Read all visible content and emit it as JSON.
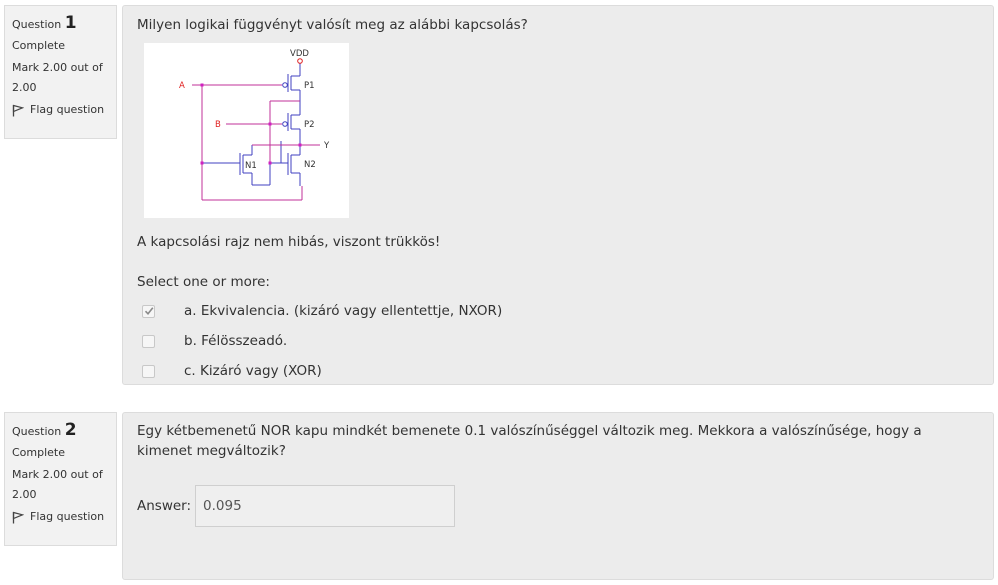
{
  "questions": [
    {
      "prefix": "Question",
      "number": "1",
      "state": "Complete",
      "mark": "Mark 2.00 out of 2.00",
      "flag_label": "Flag question",
      "text": "Milyen logikai függvényt valósít meg az alábbi kapcsolás?",
      "circuit_labels": {
        "vdd": "VDD",
        "a": "A",
        "b": "B",
        "y": "Y",
        "p1": "P1",
        "p2": "P2",
        "n1": "N1",
        "n2": "N2"
      },
      "note": "A kapcsolási rajz nem hibás, viszont trükkös!",
      "prompt": "Select one or more:",
      "options": [
        {
          "label": "a. Ekvivalencia. (kizáró vagy ellentettje, NXOR)",
          "checked": true
        },
        {
          "label": "b. Félösszeadó.",
          "checked": false
        },
        {
          "label": "c. Kizáró vagy (XOR)",
          "checked": false
        }
      ]
    },
    {
      "prefix": "Question",
      "number": "2",
      "state": "Complete",
      "mark": "Mark 2.00 out of 2.00",
      "flag_label": "Flag question",
      "text": "Egy kétbemenetű NOR kapu mindkét bemenete 0.1 valószínűséggel változik meg. Mekkora a valószínűsége, hogy a kimenet megváltozik?",
      "answer_label": "Answer:",
      "answer_value": "0.095"
    }
  ],
  "colors": {
    "wire_blue": "#4040c0",
    "wire_magenta": "#c0309a",
    "label_red": "#e02020",
    "panel_bg": "#ececec",
    "info_bg": "#f2f2f2"
  }
}
